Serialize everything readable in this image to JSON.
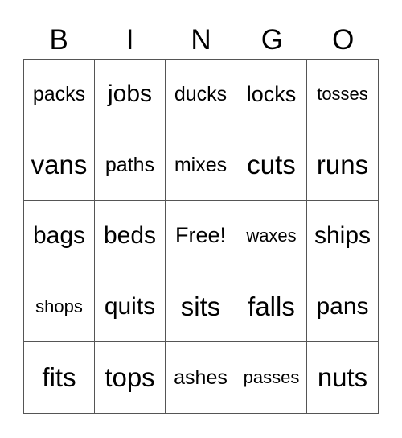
{
  "header": [
    "B",
    "I",
    "N",
    "G",
    "O"
  ],
  "cells": [
    [
      "packs",
      "jobs",
      "ducks",
      "locks",
      "tosses"
    ],
    [
      "vans",
      "paths",
      "mixes",
      "cuts",
      "runs"
    ],
    [
      "bags",
      "beds",
      "Free!",
      "waxes",
      "ships"
    ],
    [
      "shops",
      "quits",
      "sits",
      "falls",
      "pans"
    ],
    [
      "fits",
      "tops",
      "ashes",
      "passes",
      "nuts"
    ]
  ]
}
